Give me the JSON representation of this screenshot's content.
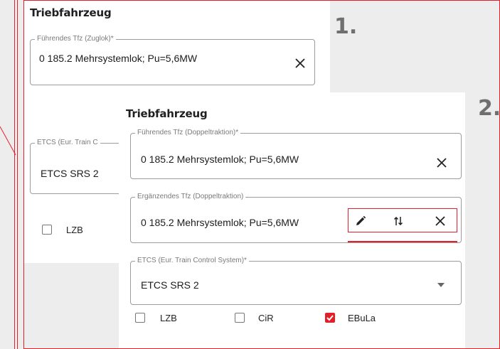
{
  "steps": {
    "one": "1.",
    "two": "2."
  },
  "panel1": {
    "heading": "Triebfahrzeug",
    "lead_loco": {
      "legend": "Führendes Tfz (Zuglok)*",
      "value": "0 185.2 Mehrsystemlok; Pu=5,6MW",
      "clear_icon": "close-icon"
    },
    "etcs": {
      "legend": "ETCS (Eur. Train C",
      "value": "ETCS SRS 2"
    },
    "checkbox_lzb": {
      "label": "LZB",
      "checked": false
    }
  },
  "panel2": {
    "heading": "Triebfahrzeug",
    "lead_loco": {
      "legend": "Führendes Tfz (Doppeltraktion)*",
      "value": "0 185.2 Mehrsystemlok; Pu=5,6MW",
      "clear_icon": "close-icon"
    },
    "extra_loco": {
      "legend": "Ergänzendes Tfz (Doppeltraktion)",
      "value": "0 185.2 Mehrsystemlok; Pu=5,6MW",
      "icons": [
        "pencil-icon",
        "swap-icon",
        "close-icon"
      ]
    },
    "etcs": {
      "legend": "ETCS (Eur. Train Control System)*",
      "value": "ETCS SRS 2",
      "dropdown_icon": "caret-down-icon"
    },
    "checkboxes": [
      {
        "label": "LZB",
        "checked": false
      },
      {
        "label": "CiR",
        "checked": false
      },
      {
        "label": "EBuLa",
        "checked": true
      }
    ]
  },
  "colors": {
    "highlight": "#e3202a",
    "background": "#ededed",
    "step_number": "#6f6f6f"
  }
}
